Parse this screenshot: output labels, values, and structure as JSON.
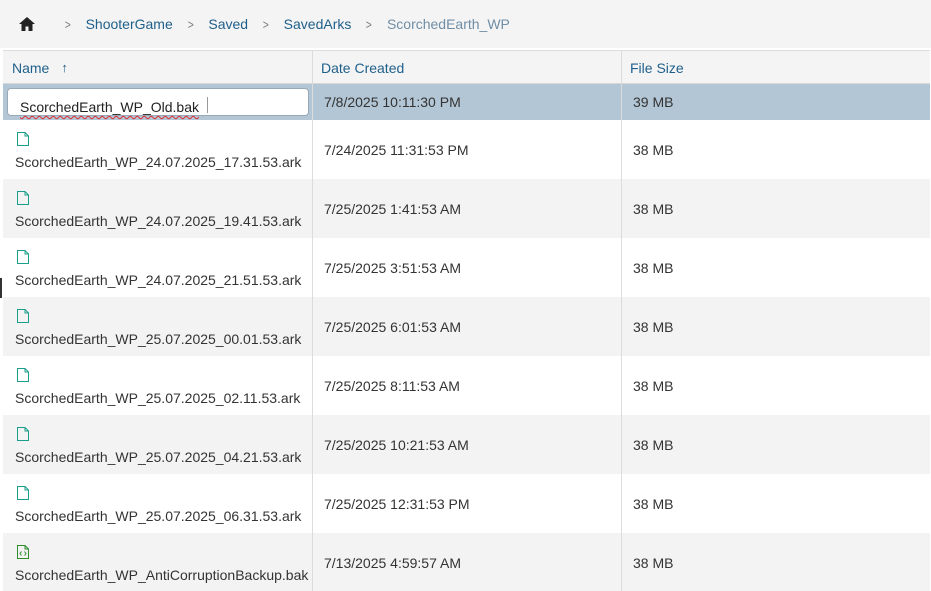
{
  "breadcrumb": {
    "home_icon": "home-icon",
    "items": [
      "ShooterGame",
      "Saved",
      "SavedArks"
    ],
    "current": "ScorchedEarth_WP",
    "separator": ">"
  },
  "columns": {
    "name": "Name",
    "date": "Date Created",
    "size": "File Size",
    "sort_indicator": "↑"
  },
  "rename_row": {
    "value": "ScorchedEarth_WP_Old.bak",
    "date": "7/8/2025 10:11:30 PM",
    "size": "39 MB"
  },
  "files": [
    {
      "name": "ScorchedEarth_WP_24.07.2025_17.31.53.ark",
      "date": "7/24/2025 11:31:53 PM",
      "size": "38 MB",
      "icon": "file-icon"
    },
    {
      "name": "ScorchedEarth_WP_24.07.2025_19.41.53.ark",
      "date": "7/25/2025 1:41:53 AM",
      "size": "38 MB",
      "icon": "file-icon"
    },
    {
      "name": "ScorchedEarth_WP_24.07.2025_21.51.53.ark",
      "date": "7/25/2025 3:51:53 AM",
      "size": "38 MB",
      "icon": "file-icon"
    },
    {
      "name": "ScorchedEarth_WP_25.07.2025_00.01.53.ark",
      "date": "7/25/2025 6:01:53 AM",
      "size": "38 MB",
      "icon": "file-icon"
    },
    {
      "name": "ScorchedEarth_WP_25.07.2025_02.11.53.ark",
      "date": "7/25/2025 8:11:53 AM",
      "size": "38 MB",
      "icon": "file-icon"
    },
    {
      "name": "ScorchedEarth_WP_25.07.2025_04.21.53.ark",
      "date": "7/25/2025 10:21:53 AM",
      "size": "38 MB",
      "icon": "file-icon"
    },
    {
      "name": "ScorchedEarth_WP_25.07.2025_06.31.53.ark",
      "date": "7/25/2025 12:31:53 PM",
      "size": "38 MB",
      "icon": "file-icon"
    },
    {
      "name": "ScorchedEarth_WP_AntiCorruptionBackup.bak",
      "date": "7/13/2025 4:59:57 AM",
      "size": "38 MB",
      "icon": "code-file-icon"
    }
  ],
  "colors": {
    "link": "#1f5f8b",
    "file_icon": "#1a9e8a",
    "code_icon": "#2e8b2e",
    "selected_row": "#b3c6d5"
  }
}
